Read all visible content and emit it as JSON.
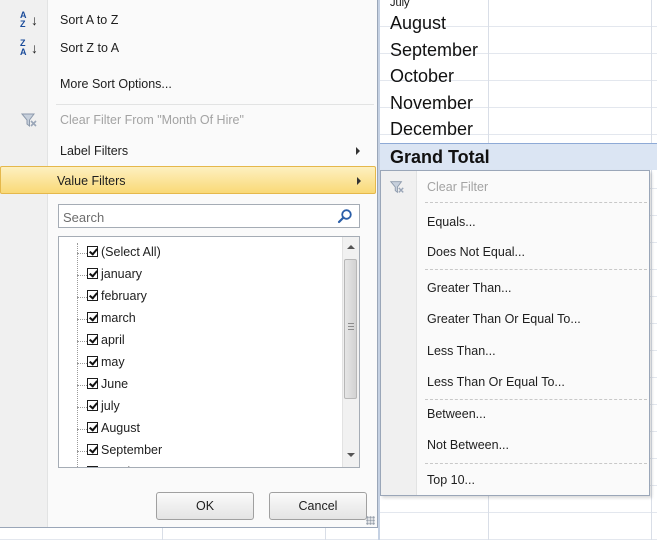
{
  "sheet": {
    "partial_month": "July",
    "months": [
      "August",
      "September",
      "October",
      "November",
      "December"
    ],
    "grand_total": "Grand Total"
  },
  "menu": {
    "sort_a_to_z": "Sort A to Z",
    "sort_z_to_a": "Sort Z to A",
    "more_sort_options": "More Sort Options...",
    "clear_filter": "Clear Filter From \"Month Of Hire\"",
    "label_filters": "Label Filters",
    "value_filters": "Value Filters",
    "sort_icon_a": "A",
    "sort_icon_z": "Z"
  },
  "search": {
    "placeholder": "Search"
  },
  "checklist": {
    "items": [
      {
        "label": "(Select All)",
        "checked": true
      },
      {
        "label": "january",
        "checked": true
      },
      {
        "label": "february",
        "checked": true
      },
      {
        "label": "march",
        "checked": true
      },
      {
        "label": "april",
        "checked": true
      },
      {
        "label": "may",
        "checked": true
      },
      {
        "label": "June",
        "checked": true
      },
      {
        "label": "july",
        "checked": true
      },
      {
        "label": "August",
        "checked": true
      },
      {
        "label": "September",
        "checked": true
      },
      {
        "label": "October",
        "checked": true
      }
    ]
  },
  "buttons": {
    "ok": "OK",
    "cancel": "Cancel"
  },
  "submenu": {
    "clear_filter": "Clear Filter",
    "equals": "Equals...",
    "does_not_equal": "Does Not Equal...",
    "greater_than": "Greater Than...",
    "greater_than_or_equal": "Greater Than Or Equal To...",
    "less_than": "Less Than...",
    "less_than_or_equal": "Less Than Or Equal To...",
    "between": "Between...",
    "not_between": "Not Between...",
    "top_10": "Top 10..."
  },
  "colors": {
    "highlight": "#f9d977",
    "grand_total_fill": "#dbe5f3",
    "sort_icon": "#1a4b9a",
    "disabled_text": "#a3a3a3"
  },
  "icons": {
    "sort_asc": "sort-a-to-z-icon",
    "sort_desc": "sort-z-to-a-icon",
    "clear_filter": "clear-filter-icon",
    "search": "magnifier-icon"
  }
}
